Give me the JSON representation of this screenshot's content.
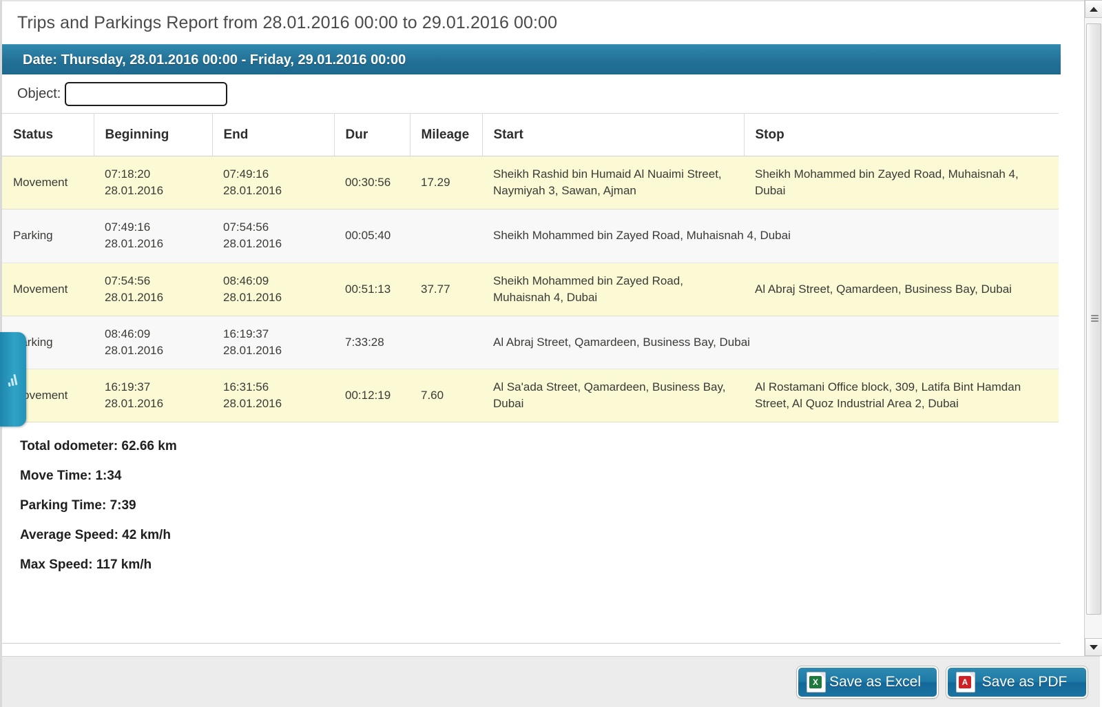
{
  "report": {
    "title": "Trips and Parkings Report from 28.01.2016 00:00 to 29.01.2016 00:00",
    "date_banner": "Date: Thursday, 28.01.2016 00:00 - Friday, 29.01.2016 00:00"
  },
  "filter": {
    "object_label": "Object:",
    "object_value": "",
    "object_placeholder": ""
  },
  "table": {
    "columns": [
      "Status",
      "Beginning",
      "End",
      "Dur",
      "Mileage",
      "Start",
      "Stop"
    ],
    "rows": [
      {
        "status": "Movement",
        "begin_time": "07:18:20",
        "begin_date": "28.01.2016",
        "end_time": "07:49:16",
        "end_date": "28.01.2016",
        "dur": "00:30:56",
        "mileage": "17.29",
        "start": "Sheikh Rashid bin Humaid Al Nuaimi Street, Naymiyah 3, Sawan, Ajman",
        "stop": "Sheikh Mohammed bin Zayed Road, Muhaisnah 4, Dubai"
      },
      {
        "status": "Parking",
        "begin_time": "07:49:16",
        "begin_date": "28.01.2016",
        "end_time": "07:54:56",
        "end_date": "28.01.2016",
        "dur": "00:05:40",
        "mileage": "",
        "start": "Sheikh Mohammed bin Zayed Road, Muhaisnah 4, Dubai",
        "stop": ""
      },
      {
        "status": "Movement",
        "begin_time": "07:54:56",
        "begin_date": "28.01.2016",
        "end_time": "08:46:09",
        "end_date": "28.01.2016",
        "dur": "00:51:13",
        "mileage": "37.77",
        "start": "Sheikh Mohammed bin Zayed Road, Muhaisnah 4, Dubai",
        "stop": "Al Abraj Street, Qamardeen, Business Bay, Dubai"
      },
      {
        "status": "Parking",
        "begin_time": "08:46:09",
        "begin_date": "28.01.2016",
        "end_time": "16:19:37",
        "end_date": "28.01.2016",
        "dur": "7:33:28",
        "mileage": "",
        "start": "Al Abraj Street, Qamardeen, Business Bay, Dubai",
        "stop": ""
      },
      {
        "status": "Movement",
        "begin_time": "16:19:37",
        "begin_date": "28.01.2016",
        "end_time": "16:31:56",
        "end_date": "28.01.2016",
        "dur": "00:12:19",
        "mileage": "7.60",
        "start": "Al Sa'ada Street, Qamardeen, Business Bay, Dubai",
        "stop": "Al Rostamani Office block, 309, Latifa Bint Hamdan Street, Al Quoz Industrial Area 2, Dubai"
      }
    ]
  },
  "summary": {
    "total_odometer": "Total odometer: 62.66 km",
    "move_time": "Move Time: 1:34",
    "parking_time": "Parking Time: 7:39",
    "average_speed": "Average Speed: 42 km/h",
    "max_speed": "Max Speed: 117 km/h"
  },
  "footer": {
    "save_excel_label": "Save as Excel",
    "save_pdf_label": "Save as PDF",
    "excel_badge": "X",
    "pdf_badge": "A"
  },
  "colors": {
    "banner_blue": "#1f6f94",
    "row_movement": "#fbfad5",
    "row_parking": "#f8f8f8",
    "button_blue": "#1d7aa5",
    "side_tab_teal": "#2fa3c6"
  }
}
